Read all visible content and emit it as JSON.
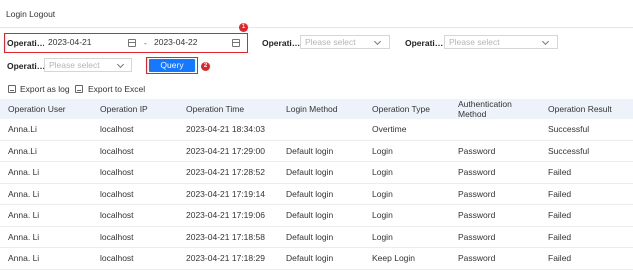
{
  "page": {
    "title": "Login Logout"
  },
  "filters": {
    "op_time_label": "Operati…",
    "date_from": "2023-04-21",
    "date_separator": "-",
    "date_to": "2023-04-22",
    "op_type_label": "Operati…",
    "op_type_placeholder": "Please select",
    "op_result_label": "Operati…",
    "op_result_placeholder": "Please select",
    "op_user_label": "Operati…",
    "op_user_placeholder": "Please select",
    "query_label": "Query",
    "badge_1": "1",
    "badge_2": "2"
  },
  "toolbar": {
    "export_log": "Export as log",
    "export_excel": "Export to Excel"
  },
  "table": {
    "columns": [
      "Operation User",
      "Operation IP",
      "Operation Time",
      "Login Method",
      "Operation Type",
      "Authentication Method",
      "Operation Result"
    ],
    "rows": [
      [
        "Anna.Li",
        "localhost",
        "2023-04-21 18:34:03",
        "",
        "Overtime",
        "",
        "Successful"
      ],
      [
        "Anna.Li",
        "localhost",
        "2023-04-21 17:29:00",
        "Default login",
        "Login",
        "Password",
        "Successful"
      ],
      [
        "Anna. Li",
        "localhost",
        "2023-04-21 17:28:52",
        "Default login",
        "Login",
        "Password",
        "Failed"
      ],
      [
        "Anna. Li",
        "localhost",
        "2023-04-21 17:19:14",
        "Default login",
        "Login",
        "Password",
        "Failed"
      ],
      [
        "Anna. Li",
        "localhost",
        "2023-04-21 17:19:06",
        "Default login",
        "Login",
        "Password",
        "Failed"
      ],
      [
        "Anna. Li",
        "localhost",
        "2023-04-21 17:18:58",
        "Default login",
        "Login",
        "Password",
        "Failed"
      ],
      [
        "Anna. Li",
        "localhost",
        "2023-04-21 17:18:29",
        "Default login",
        "Keep Login",
        "Password",
        "Failed"
      ]
    ]
  },
  "colors": {
    "accent": "#1677ff",
    "highlight": "#e0242b",
    "header_bg": "#eef3fb"
  }
}
